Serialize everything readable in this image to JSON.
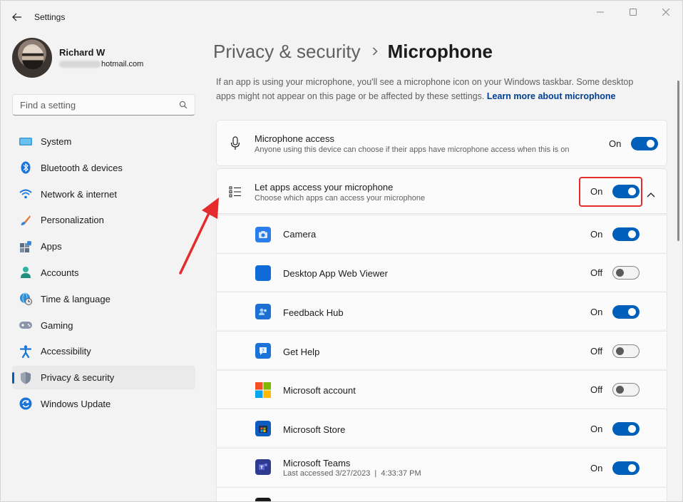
{
  "window": {
    "title": "Settings"
  },
  "profile": {
    "name": "Richard W",
    "email_domain": "hotmail.com"
  },
  "search": {
    "placeholder": "Find a setting"
  },
  "sidebar": {
    "items": [
      {
        "label": "System",
        "icon": "system-icon"
      },
      {
        "label": "Bluetooth & devices",
        "icon": "bluetooth-icon"
      },
      {
        "label": "Network & internet",
        "icon": "wifi-icon"
      },
      {
        "label": "Personalization",
        "icon": "brush-icon"
      },
      {
        "label": "Apps",
        "icon": "apps-icon"
      },
      {
        "label": "Accounts",
        "icon": "accounts-icon"
      },
      {
        "label": "Time & language",
        "icon": "globe-clock-icon"
      },
      {
        "label": "Gaming",
        "icon": "gamepad-icon"
      },
      {
        "label": "Accessibility",
        "icon": "accessibility-icon"
      },
      {
        "label": "Privacy & security",
        "icon": "shield-icon",
        "selected": true
      },
      {
        "label": "Windows Update",
        "icon": "update-icon"
      }
    ]
  },
  "breadcrumb": {
    "parent": "Privacy & security",
    "current": "Microphone"
  },
  "intro": {
    "text": "If an app is using your microphone, you'll see a microphone icon on your Windows taskbar. Some desktop apps might not appear on this page or be affected by these settings.",
    "link": "Learn more about microphone"
  },
  "mic_access": {
    "title": "Microphone access",
    "subtitle": "Anyone using this device can choose if their apps have microphone access when this is on",
    "state": "On"
  },
  "let_apps": {
    "title": "Let apps access your microphone",
    "subtitle": "Choose which apps can access your microphone",
    "state": "On"
  },
  "apps": [
    {
      "name": "Camera",
      "state": "On",
      "icon": "camera-app-icon",
      "color": "#2b7de9"
    },
    {
      "name": "Desktop App Web Viewer",
      "state": "Off",
      "icon": "webviewer-app-icon",
      "color": "#0f6cd6"
    },
    {
      "name": "Feedback Hub",
      "state": "On",
      "icon": "feedback-hub-app-icon",
      "color": "#1d6fd1"
    },
    {
      "name": "Get Help",
      "state": "Off",
      "icon": "get-help-app-icon",
      "color": "#1b73d8"
    },
    {
      "name": "Microsoft account",
      "state": "Off",
      "icon": "microsoft-logo-icon",
      "color": "#f25022"
    },
    {
      "name": "Microsoft Store",
      "state": "On",
      "icon": "store-app-icon",
      "color": "#0f5cc0"
    },
    {
      "name": "Microsoft Teams",
      "state": "On",
      "icon": "teams-app-icon",
      "color": "#4b53bc",
      "sub": "Last accessed 3/27/2023  |  4:33:37 PM"
    }
  ],
  "colors": {
    "accent": "#005fb8",
    "annotation": "#e52b2b"
  }
}
